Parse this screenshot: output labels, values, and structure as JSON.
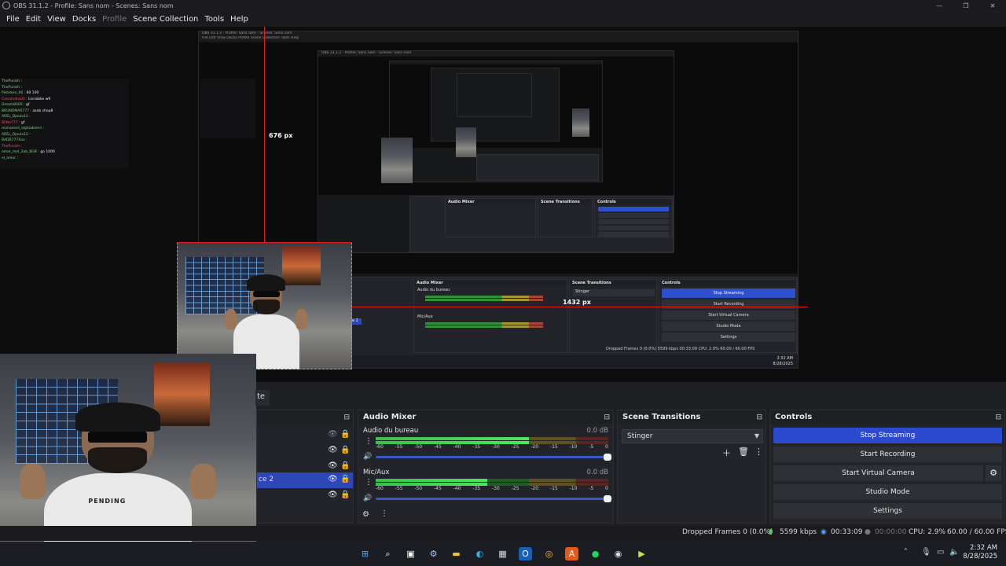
{
  "window": {
    "title": "OBS 31.1.2 - Profile: Sans nom - Scenes: Sans nom",
    "controls": [
      "—",
      "❐",
      "✕"
    ]
  },
  "menu": {
    "file": "File",
    "edit": "Edit",
    "view": "View",
    "docks": "Docks",
    "profile": "Profile",
    "scene_collection": "Scene Collection",
    "tools": "Tools",
    "help": "Help"
  },
  "nested": {
    "title": "OBS 31.1.2 - Profile: Sans nom - Scenes: Sans nom",
    "menu": "File   Edit   View   Docks   Profile   Scene Collection   Tools   Help",
    "mixer": "Audio Mixer",
    "transitions": "Scene Transitions",
    "controls": "Controls",
    "ch1": "Audio du bureau",
    "ch2": "Mic/Aux",
    "stinger": "Stinger",
    "btn_stop": "Stop Streaming",
    "btn_rec": "Start Recording",
    "btn_vcam": "Start Virtual Camera",
    "btn_studio": "Studio Mode",
    "btn_settings": "Settings",
    "status": "Dropped Frames 0 (0.0%)   5599 kbps   00:33:09   CPU: 2.9%   60.00 / 60.00 FPS",
    "clock_time": "2:32 AM",
    "clock_date": "8/28/2025",
    "scene_frag": "e 2"
  },
  "measure": {
    "height": "676 px",
    "width": "1432 px"
  },
  "chat": [
    {
      "user": "ThePunish :",
      "msg": ""
    },
    {
      "user": "ThePunish :",
      "msg": ""
    },
    {
      "user": "Pistolero_06 :",
      "msg": "60 100"
    },
    {
      "user": "Cassandrastt :",
      "msg": "Livraibke w9"
    },
    {
      "user": "Dream8000 :",
      "msg": "gf"
    },
    {
      "user": "BRUNOMAR777 :",
      "msg": "azob shop8"
    },
    {
      "user": "AREL_Djoulo12 :",
      "msg": ""
    },
    {
      "user": "Blitte777 :",
      "msg": "gf"
    },
    {
      "user": "mohamed_alghiabsmri :",
      "msg": ""
    },
    {
      "user": "AREL_Djoulo12 :",
      "msg": ""
    },
    {
      "user": "BADR777Xxx :",
      "msg": ""
    },
    {
      "user": "ThePunish :",
      "msg": ""
    },
    {
      "user": "omar_mol_3ab_BGB :",
      "msg": "go 1000"
    },
    {
      "user": "el_amor :",
      "msg": ""
    }
  ],
  "shirt_text": "PENDING",
  "dock": {
    "scenes_fragment": "te",
    "sources_selected_fragment": "ce 2",
    "mixer": {
      "title": "Audio Mixer",
      "channels": [
        {
          "name": "Audio du bureau",
          "db": "0.0 dB",
          "level": 0.66
        },
        {
          "name": "Mic/Aux",
          "db": "0.0 dB",
          "level": 0.48
        }
      ],
      "ticks": [
        "-60",
        "-55",
        "-50",
        "-45",
        "-40",
        "-35",
        "-30",
        "-25",
        "-20",
        "-15",
        "-10",
        "-5",
        "0"
      ]
    },
    "transitions": {
      "title": "Scene Transitions",
      "selected": "Stinger"
    },
    "controls": {
      "title": "Controls",
      "stop_streaming": "Stop Streaming",
      "start_recording": "Start Recording",
      "start_virtual_camera": "Start Virtual Camera",
      "studio_mode": "Studio Mode",
      "settings": "Settings"
    }
  },
  "status": {
    "dropped": "Dropped Frames 0 (0.0%)",
    "kbps": "5599 kbps",
    "stream_time": "00:33:09",
    "rec_time": "00:00:00",
    "cpu": "CPU: 2.9%",
    "fps": "60.00 / 60.00 FPS"
  },
  "taskbar": {
    "time": "2:32 AM",
    "date": "8/28/2025"
  },
  "colors": {
    "accent_blue": "#2c4ad0",
    "measure_red": "#e02020",
    "guide_green": "#2de05a"
  }
}
